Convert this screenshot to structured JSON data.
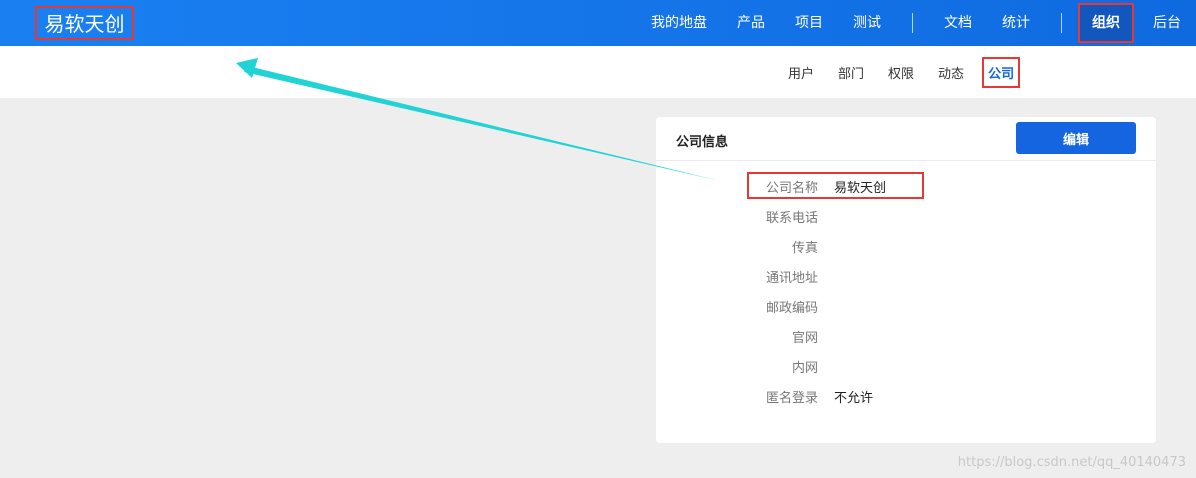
{
  "brand": "易软天创",
  "main_nav": {
    "group1": [
      "我的地盘",
      "产品",
      "项目",
      "测试"
    ],
    "group2": [
      "文档",
      "统计"
    ],
    "active": "组织",
    "last": "后台"
  },
  "sub_nav": {
    "items": [
      "用户",
      "部门",
      "权限",
      "动态"
    ],
    "active": "公司"
  },
  "card": {
    "title": "公司信息",
    "edit_label": "编辑",
    "fields": [
      {
        "label": "公司名称",
        "value": "易软天创"
      },
      {
        "label": "联系电话",
        "value": ""
      },
      {
        "label": "传真",
        "value": ""
      },
      {
        "label": "通讯地址",
        "value": ""
      },
      {
        "label": "邮政编码",
        "value": ""
      },
      {
        "label": "官网",
        "value": ""
      },
      {
        "label": "内网",
        "value": ""
      },
      {
        "label": "匿名登录",
        "value": "不允许"
      }
    ]
  },
  "watermark": "https://blog.csdn.net/qq_40140473",
  "colors": {
    "primary": "#1565e0",
    "topbar": "#1a80f2",
    "annotation_red": "#e53935",
    "annotation_arrow": "#22d3d6"
  }
}
